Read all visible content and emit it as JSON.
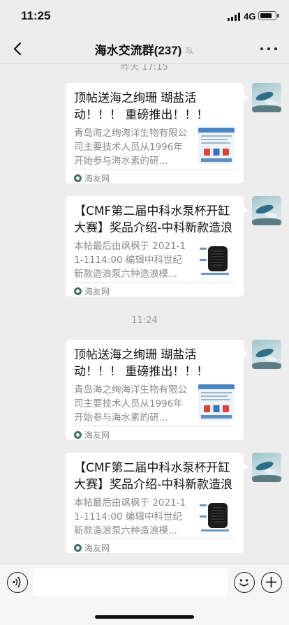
{
  "status_bar": {
    "time": "11:25",
    "network": "4G",
    "battery_level": 0.7
  },
  "nav": {
    "back_icon": "chevron-left-icon",
    "title": "海水交流群(237)",
    "mute_icon": "bell-slash-icon",
    "more_icon": "ellipsis-icon"
  },
  "chat": {
    "timestamps": [
      "昨天 17:15",
      "11:24"
    ],
    "messages": [
      {
        "title": "顶帖送海之绚珊 瑚盐活动！！！ 重磅推出！！！",
        "description": "青岛海之绚海洋生物有限公司主要技术人员从1996年开始参与海水素的研...",
        "source": "海友网",
        "thumbnail": "salt-product-flyer"
      },
      {
        "title": "【CMF第二届中科水泵杯开缸大赛】奖品介绍-中科新款造浪泵",
        "description": "本帖最后由飒枫于 2021-11-1114:00 编辑中科世纪新款造浪泵六种造浪模...",
        "source": "海友网",
        "thumbnail": "wave-pump"
      },
      {
        "title": "顶帖送海之绚珊 瑚盐活动！！！ 重磅推出！！！",
        "description": "青岛海之绚海洋生物有限公司主要技术人员从1996年开始参与海水素的研...",
        "source": "海友网",
        "thumbnail": "salt-product-flyer"
      },
      {
        "title": "【CMF第二届中科水泵杯开缸大赛】奖品介绍-中科新款造浪泵",
        "description": "本帖最后由飒枫于 2021-11-1114:00 编辑中科世纪新款造浪泵六种造浪模...",
        "source": "海友网",
        "thumbnail": "wave-pump"
      }
    ]
  },
  "input_bar": {
    "voice_icon": "voice-icon",
    "input_value": "",
    "emoji_icon": "emoji-icon",
    "plus_icon": "plus-circle-icon"
  }
}
